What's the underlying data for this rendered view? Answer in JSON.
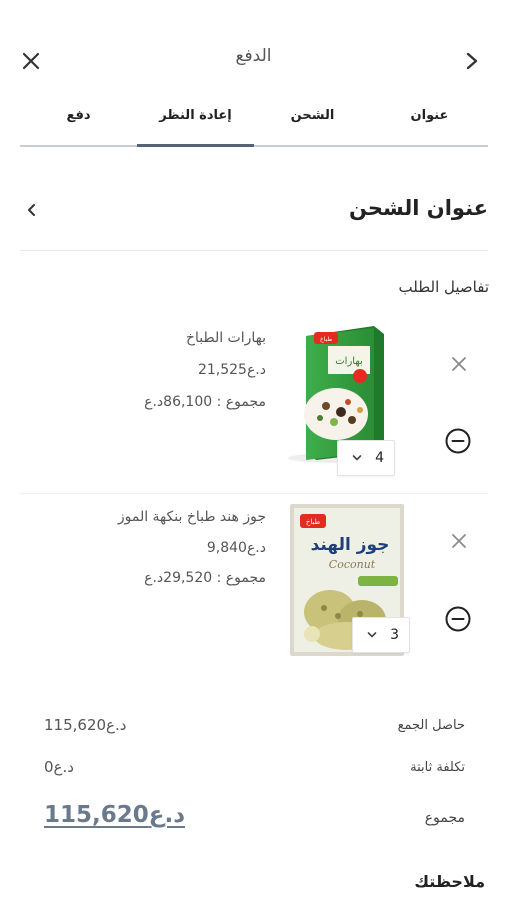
{
  "header": {
    "title": "الدفع",
    "close_icon": "close-icon",
    "back_icon": "chevron-right-icon"
  },
  "steps": [
    {
      "label": "عنوان",
      "active": false
    },
    {
      "label": "الشحن",
      "active": false
    },
    {
      "label": "إعادة النظر",
      "active": true
    },
    {
      "label": "دفع",
      "active": false
    }
  ],
  "shipping": {
    "title": "عنوان الشحن",
    "icon": "chevron-left-icon"
  },
  "order": {
    "title": "تفاصيل الطلب",
    "items": [
      {
        "name": "بهارات الطباخ",
        "price": "21,525د.ع",
        "total": "مجموع : 86,100د.ع",
        "quantity": "4"
      },
      {
        "name": "جوز هند طباخ بنكهة الموز",
        "price": "9,840د.ع",
        "total": "مجموع : 29,520د.ع",
        "quantity": "3"
      }
    ]
  },
  "summary": {
    "subtotal_label": "حاصل الجمع",
    "subtotal_value": "115,620د.ع",
    "fixed_cost_label": "تكلفة ثابتة",
    "fixed_cost_value": "0د.ع",
    "total_label": "مجموع",
    "total_value": "115,620د.ع"
  },
  "notes": {
    "label": "ملاحظتك"
  },
  "colors": {
    "accent": "#546474",
    "price_total": "#6a7a8c"
  }
}
